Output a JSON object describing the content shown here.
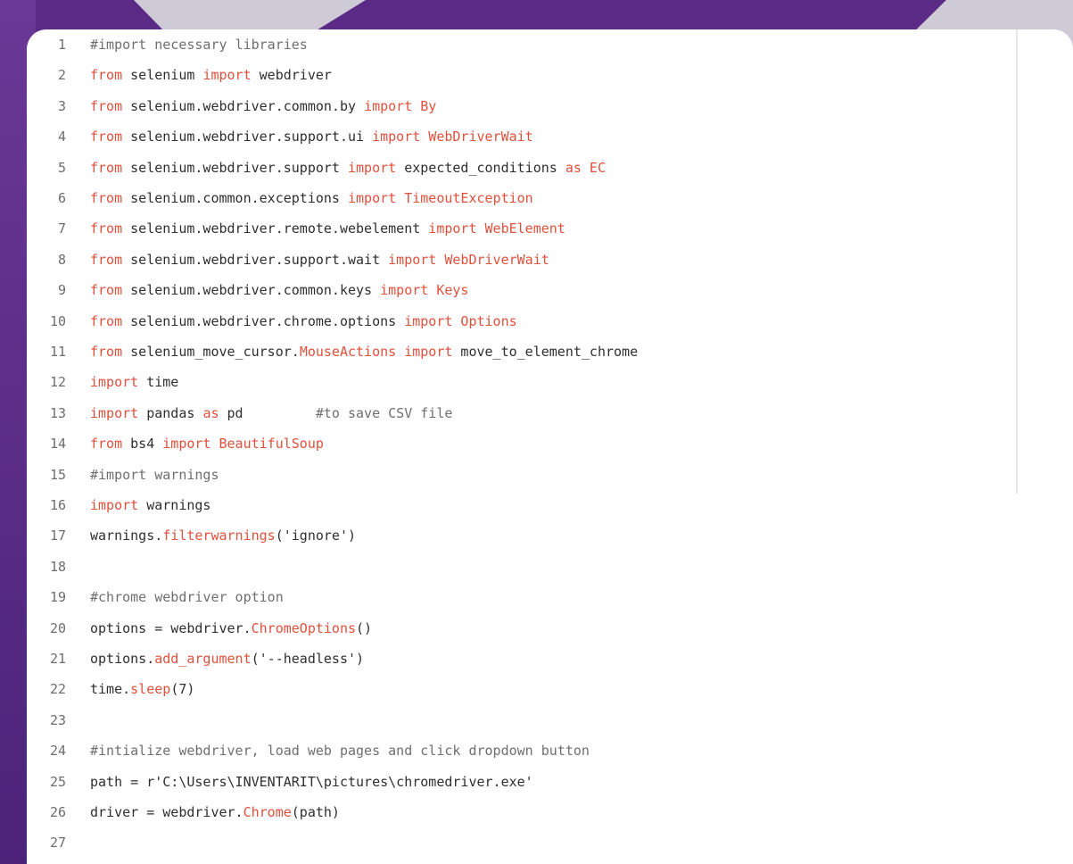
{
  "colors": {
    "background": "#5a2a86",
    "keyword": "#e0513c",
    "text": "#2f2f2f",
    "comment": "#6f6f6f",
    "line_number": "#6e6e6e"
  },
  "lines": [
    {
      "n": "1",
      "tokens": [
        {
          "t": "#import necessary libraries",
          "c": "cm"
        }
      ]
    },
    {
      "n": "2",
      "tokens": [
        {
          "t": "from",
          "c": "kw"
        },
        {
          "t": " selenium ",
          "c": ""
        },
        {
          "t": "import",
          "c": "kw"
        },
        {
          "t": " webdriver",
          "c": ""
        }
      ]
    },
    {
      "n": "3",
      "tokens": [
        {
          "t": "from",
          "c": "kw"
        },
        {
          "t": " selenium.webdriver.common.by ",
          "c": ""
        },
        {
          "t": "import",
          "c": "kw"
        },
        {
          "t": " By",
          "c": "fn"
        }
      ]
    },
    {
      "n": "4",
      "tokens": [
        {
          "t": "from",
          "c": "kw"
        },
        {
          "t": " selenium.webdriver.support.ui ",
          "c": ""
        },
        {
          "t": "import",
          "c": "kw"
        },
        {
          "t": " WebDriverWait",
          "c": "fn"
        }
      ]
    },
    {
      "n": "5",
      "tokens": [
        {
          "t": "from",
          "c": "kw"
        },
        {
          "t": " selenium.webdriver.support ",
          "c": ""
        },
        {
          "t": "import",
          "c": "kw"
        },
        {
          "t": " expected_conditions ",
          "c": ""
        },
        {
          "t": "as",
          "c": "kw"
        },
        {
          "t": " EC",
          "c": "fn"
        }
      ]
    },
    {
      "n": "6",
      "tokens": [
        {
          "t": "from",
          "c": "kw"
        },
        {
          "t": " selenium.common.exceptions ",
          "c": ""
        },
        {
          "t": "import",
          "c": "kw"
        },
        {
          "t": " TimeoutException",
          "c": "fn"
        }
      ]
    },
    {
      "n": "7",
      "tokens": [
        {
          "t": "from",
          "c": "kw"
        },
        {
          "t": " selenium.webdriver.remote.webelement ",
          "c": ""
        },
        {
          "t": "import",
          "c": "kw"
        },
        {
          "t": " WebElement",
          "c": "fn"
        }
      ]
    },
    {
      "n": "8",
      "tokens": [
        {
          "t": "from",
          "c": "kw"
        },
        {
          "t": " selenium.webdriver.support.wait ",
          "c": ""
        },
        {
          "t": "import",
          "c": "kw"
        },
        {
          "t": " WebDriverWait",
          "c": "fn"
        }
      ]
    },
    {
      "n": "9",
      "tokens": [
        {
          "t": "from",
          "c": "kw"
        },
        {
          "t": " selenium.webdriver.common.keys ",
          "c": ""
        },
        {
          "t": "import",
          "c": "kw"
        },
        {
          "t": " Keys",
          "c": "fn"
        }
      ]
    },
    {
      "n": "10",
      "tokens": [
        {
          "t": "from",
          "c": "kw"
        },
        {
          "t": " selenium.webdriver.chrome.options ",
          "c": ""
        },
        {
          "t": "import",
          "c": "kw"
        },
        {
          "t": " Options",
          "c": "fn"
        }
      ]
    },
    {
      "n": "11",
      "tokens": [
        {
          "t": "from",
          "c": "kw"
        },
        {
          "t": " selenium_move_cursor.",
          "c": ""
        },
        {
          "t": "MouseActions",
          "c": "fn"
        },
        {
          "t": " ",
          "c": ""
        },
        {
          "t": "import",
          "c": "kw"
        },
        {
          "t": " move_to_element_chrome",
          "c": ""
        }
      ]
    },
    {
      "n": "12",
      "tokens": [
        {
          "t": "import",
          "c": "kw"
        },
        {
          "t": " time",
          "c": ""
        }
      ]
    },
    {
      "n": "13",
      "tokens": [
        {
          "t": "import",
          "c": "kw"
        },
        {
          "t": " pandas ",
          "c": ""
        },
        {
          "t": "as",
          "c": "kw"
        },
        {
          "t": " pd         ",
          "c": ""
        },
        {
          "t": "#to save CSV file",
          "c": "cm"
        }
      ]
    },
    {
      "n": "14",
      "tokens": [
        {
          "t": "from",
          "c": "kw"
        },
        {
          "t": " bs4 ",
          "c": ""
        },
        {
          "t": "import",
          "c": "kw"
        },
        {
          "t": " BeautifulSoup",
          "c": "fn"
        }
      ]
    },
    {
      "n": "15",
      "tokens": [
        {
          "t": "#import warnings",
          "c": "cm"
        }
      ]
    },
    {
      "n": "16",
      "tokens": [
        {
          "t": "import",
          "c": "kw"
        },
        {
          "t": " warnings",
          "c": ""
        }
      ]
    },
    {
      "n": "17",
      "tokens": [
        {
          "t": "warnings.",
          "c": ""
        },
        {
          "t": "filterwarnings",
          "c": "fn"
        },
        {
          "t": "('ignore')",
          "c": ""
        }
      ]
    },
    {
      "n": "18",
      "tokens": []
    },
    {
      "n": "19",
      "tokens": [
        {
          "t": "#chrome webdriver option",
          "c": "cm"
        }
      ]
    },
    {
      "n": "20",
      "tokens": [
        {
          "t": "options = webdriver.",
          "c": ""
        },
        {
          "t": "ChromeOptions",
          "c": "fn"
        },
        {
          "t": "()",
          "c": ""
        }
      ]
    },
    {
      "n": "21",
      "tokens": [
        {
          "t": "options.",
          "c": ""
        },
        {
          "t": "add_argument",
          "c": "fn"
        },
        {
          "t": "('--headless')",
          "c": ""
        }
      ]
    },
    {
      "n": "22",
      "tokens": [
        {
          "t": "time.",
          "c": ""
        },
        {
          "t": "sleep",
          "c": "fn"
        },
        {
          "t": "(7)",
          "c": ""
        }
      ]
    },
    {
      "n": "23",
      "tokens": []
    },
    {
      "n": "24",
      "tokens": [
        {
          "t": "#intialize webdriver, load web pages and click dropdown button",
          "c": "cm"
        }
      ]
    },
    {
      "n": "25",
      "tokens": [
        {
          "t": "path = r'C:\\Users\\INVENTARIT\\pictures\\chromedriver.exe'",
          "c": ""
        }
      ]
    },
    {
      "n": "26",
      "tokens": [
        {
          "t": "driver = webdriver.",
          "c": ""
        },
        {
          "t": "Chrome",
          "c": "fn"
        },
        {
          "t": "(path)",
          "c": ""
        }
      ]
    },
    {
      "n": "27",
      "tokens": []
    }
  ]
}
